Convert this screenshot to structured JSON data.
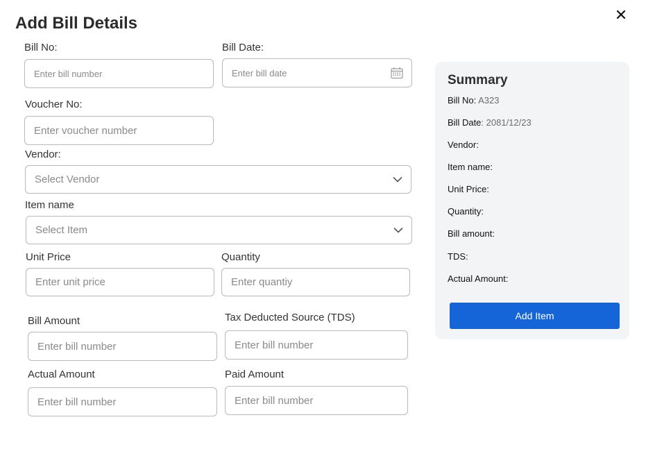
{
  "title": "Add Bill Details",
  "close": "×",
  "form": {
    "bill_no": {
      "label": "Bill No:",
      "placeholder": "Enter bill number"
    },
    "bill_date": {
      "label": "Bill Date:",
      "placeholder": "Enter bill date"
    },
    "voucher_no": {
      "label": "Voucher No:",
      "placeholder": "Enter voucher number"
    },
    "vendor": {
      "label": "Vendor:",
      "placeholder": "Select Vendor"
    },
    "item_name": {
      "label": "Item name",
      "placeholder": "Select Item"
    },
    "unit_price": {
      "label": "Unit Price",
      "placeholder": "Enter unit price"
    },
    "quantity": {
      "label": "Quantity",
      "placeholder": "Enter quantiy"
    },
    "bill_amount": {
      "label": "Bill Amount",
      "placeholder": "Enter bill number"
    },
    "tds": {
      "label": "Tax Deducted Source (TDS)",
      "placeholder": "Enter bill number"
    },
    "actual_amount": {
      "label": "Actual Amount",
      "placeholder": "Enter bill number"
    },
    "paid_amount": {
      "label": "Paid Amount",
      "placeholder": "Enter bill number"
    }
  },
  "summary": {
    "title": "Summary",
    "rows": [
      {
        "label": "Bill No:",
        "value": " A323"
      },
      {
        "label": "Bill Date",
        "value": ": 2081/12/23"
      },
      {
        "label": "Vendor:",
        "value": ""
      },
      {
        "label": "Item name:",
        "value": ""
      },
      {
        "label": "Unit Price:",
        "value": ""
      },
      {
        "label": "Quantity:",
        "value": ""
      },
      {
        "label": "Bill amount:",
        "value": ""
      },
      {
        "label": "TDS:",
        "value": ""
      },
      {
        "label": "Actual Amount:",
        "value": ""
      }
    ],
    "button_label": "Add Item"
  },
  "colors": {
    "accent": "#1565d8",
    "panel": "#f3f4f6",
    "border": "#b9b9b9"
  },
  "icons": {
    "close": "close-icon",
    "date": "calendar-icon",
    "dropdown": "chevron-down-icon"
  }
}
